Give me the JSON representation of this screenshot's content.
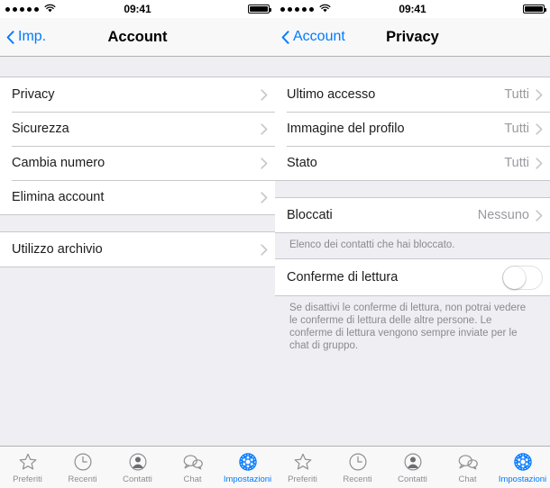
{
  "status_bar": {
    "signal_dots": 5,
    "wifi_icon": "wifi-icon",
    "time": "09:41",
    "battery_icon": "battery-icon"
  },
  "left_screen": {
    "nav": {
      "back_label": "Imp.",
      "back_icon": "chevron-left-icon",
      "title": "Account"
    },
    "groups": [
      {
        "rows": [
          {
            "label": "Privacy",
            "value": "",
            "accessory": "chevron-right-icon"
          },
          {
            "label": "Sicurezza",
            "value": "",
            "accessory": "chevron-right-icon"
          },
          {
            "label": "Cambia numero",
            "value": "",
            "accessory": "chevron-right-icon"
          },
          {
            "label": "Elimina account",
            "value": "",
            "accessory": "chevron-right-icon"
          }
        ]
      },
      {
        "rows": [
          {
            "label": "Utilizzo archivio",
            "value": "",
            "accessory": "chevron-right-icon"
          }
        ]
      }
    ]
  },
  "right_screen": {
    "nav": {
      "back_label": "Account",
      "back_icon": "chevron-left-icon",
      "title": "Privacy"
    },
    "groups": [
      {
        "rows": [
          {
            "label": "Ultimo accesso",
            "value": "Tutti",
            "accessory": "chevron-right-icon"
          },
          {
            "label": "Immagine del profilo",
            "value": "Tutti",
            "accessory": "chevron-right-icon"
          },
          {
            "label": "Stato",
            "value": "Tutti",
            "accessory": "chevron-right-icon"
          }
        ]
      },
      {
        "rows": [
          {
            "label": "Bloccati",
            "value": "Nessuno",
            "accessory": "chevron-right-icon"
          }
        ],
        "footer": "Elenco dei contatti che hai bloccato."
      },
      {
        "toggle_row": {
          "label": "Conferme di lettura",
          "state": "off"
        },
        "footer": "Se disattivi le conferme di lettura, non potrai vedere le conferme di lettura delle altre persone. Le conferme di lettura vengono sempre inviate per le chat di gruppo."
      }
    ]
  },
  "tab_bar": {
    "tabs": [
      {
        "label": "Preferiti",
        "icon": "star-icon",
        "active": false
      },
      {
        "label": "Recenti",
        "icon": "clock-icon",
        "active": false
      },
      {
        "label": "Contatti",
        "icon": "person-icon",
        "active": false
      },
      {
        "label": "Chat",
        "icon": "chat-bubbles-icon",
        "active": false
      },
      {
        "label": "Impostazioni",
        "icon": "gear-icon",
        "active": true
      }
    ]
  },
  "colors": {
    "accent": "#007aff",
    "background": "#efeef3",
    "row_background": "#ffffff",
    "separator": "#c8c7cc",
    "secondary_text": "#8a8a8f"
  }
}
